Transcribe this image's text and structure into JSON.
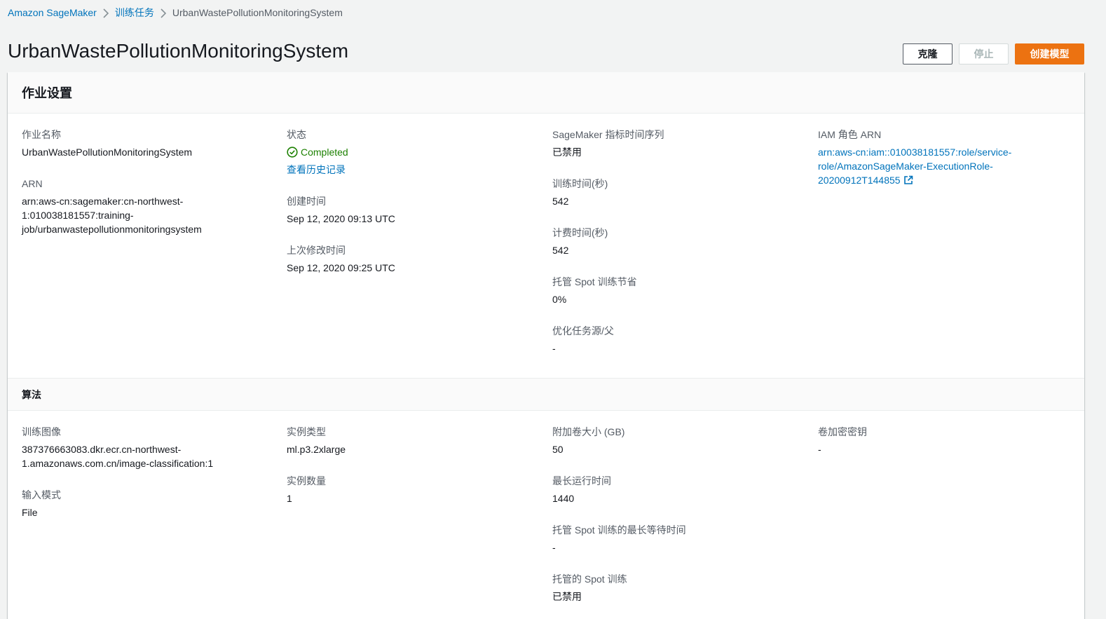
{
  "breadcrumb": {
    "root": "Amazon SageMaker",
    "parent": "训练任务",
    "current": "UrbanWastePollutionMonitoringSystem"
  },
  "page": {
    "title": "UrbanWastePollutionMonitoringSystem"
  },
  "actions": {
    "clone_label": "克隆",
    "stop_label": "停止",
    "create_model_label": "创建模型"
  },
  "job_settings": {
    "header": "作业设置",
    "job_name_label": "作业名称",
    "job_name_value": "UrbanWastePollutionMonitoringSystem",
    "arn_label": "ARN",
    "arn_line1": "arn:aws-cn:sagemaker:cn-northwest-",
    "arn_line2": "1:010038181557:training-",
    "arn_line3": "job/urbanwastepollutionmonitoringsystem",
    "status_label": "状态",
    "status_value": "Completed",
    "history_link": "查看历史记录",
    "created_label": "创建时间",
    "created_value": "Sep 12, 2020 09:13 UTC",
    "modified_label": "上次修改时间",
    "modified_value": "Sep 12, 2020 09:25 UTC",
    "metrics_label": "SageMaker 指标时间序列",
    "metrics_value": "已禁用",
    "training_time_label": "训练时间(秒)",
    "training_time_value": "542",
    "billable_time_label": "计费时间(秒)",
    "billable_time_value": "542",
    "spot_savings_label": "托管 Spot 训练节省",
    "spot_savings_value": "0%",
    "tuning_parent_label": "优化任务源/父",
    "tuning_parent_value": "-",
    "iam_label": "IAM 角色 ARN",
    "iam_line1": "arn:aws-cn:iam::010038181557:role/service-",
    "iam_line2": "role/AmazonSageMaker-ExecutionRole-",
    "iam_line3": "20200912T144855"
  },
  "algorithm": {
    "header": "算法",
    "image_label": "训练图像",
    "image_line1": "387376663083.dkr.ecr.cn-northwest-",
    "image_line2": "1.amazonaws.com.cn/image-classification:1",
    "input_mode_label": "输入模式",
    "input_mode_value": "File",
    "instance_type_label": "实例类型",
    "instance_type_value": "ml.p3.2xlarge",
    "instance_count_label": "实例数量",
    "instance_count_value": "1",
    "volume_size_label": "附加卷大小 (GB)",
    "volume_size_value": "50",
    "max_runtime_label": "最长运行时间",
    "max_runtime_value": "1440",
    "max_wait_label": "托管 Spot 训练的最长等待时间",
    "max_wait_value": "-",
    "spot_training_label": "托管的 Spot 训练",
    "spot_training_value": "已禁用",
    "volume_key_label": "卷加密密钥",
    "volume_key_value": "-"
  },
  "colors": {
    "link": "#0073bb",
    "success": "#1d8102",
    "primary": "#ec7211"
  }
}
